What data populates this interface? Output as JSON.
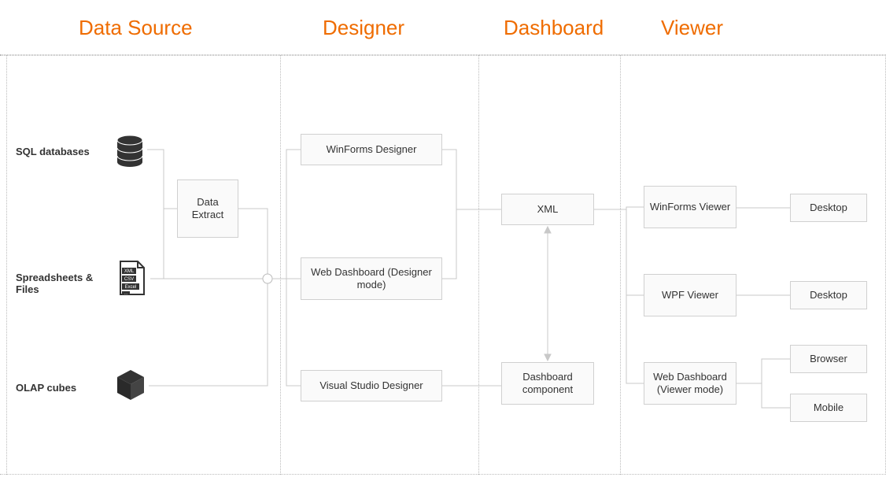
{
  "columns": {
    "data_source": "Data Source",
    "designer": "Designer",
    "dashboard": "Dashboard",
    "viewer": "Viewer"
  },
  "data_sources": {
    "sql": {
      "label": "SQL databases"
    },
    "files": {
      "label": "Spreadsheets & Files",
      "file_tags": [
        "XML",
        "CSV",
        "Excel"
      ]
    },
    "olap": {
      "label": "OLAP cubes"
    },
    "data_extract": {
      "label": "Data Extract"
    }
  },
  "designers": {
    "winforms": {
      "label": "WinForms Designer"
    },
    "web": {
      "label": "Web Dashboard (Designer mode)"
    },
    "vs": {
      "label": "Visual Studio Designer"
    }
  },
  "dashboard": {
    "xml": {
      "label": "XML"
    },
    "component": {
      "label": "Dashboard component"
    }
  },
  "viewers": {
    "winforms": {
      "label": "WinForms Viewer",
      "target": "Desktop"
    },
    "wpf": {
      "label": "WPF Viewer",
      "target": "Desktop"
    },
    "web": {
      "label": "Web Dashboard (Viewer mode)",
      "target1": "Browser",
      "target2": "Mobile"
    }
  }
}
